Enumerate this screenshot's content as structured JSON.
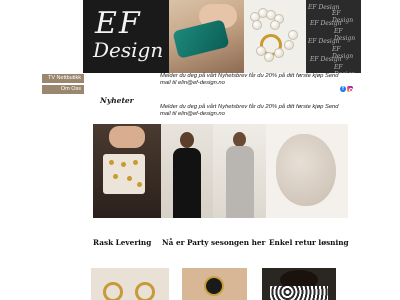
{
  "header": {
    "logo_line1": "EF",
    "logo_line2": "Design",
    "pattern_text": "EF Design"
  },
  "sidebar": {
    "items": [
      {
        "label": "TV Nettbutikk"
      },
      {
        "label": "Om Oss"
      }
    ]
  },
  "newsletter": {
    "top_text": "Melder du deg på vårt Nyhetsbrev får du 20% på ditt første kjøp Send mail til elin@ef-design.no",
    "heading": "Nyheter",
    "body_text": "Melder du deg på vårt Nyhetsbrev får du 20% på ditt første kjøp Send mail til elin@ef-design.no"
  },
  "social": {
    "facebook_icon": "facebook-icon",
    "instagram_icon": "instagram-icon"
  },
  "photos": [
    "jewelry-box",
    "woman-black-dress",
    "woman-grey-dress",
    "scarf"
  ],
  "features": {
    "shipping": "Rask Levering",
    "party": "Nå er Party sesongen her",
    "returns": "Enkel retur løsning"
  },
  "bottom_photos": [
    "earrings",
    "clover-ring",
    "leopard-dress"
  ],
  "colors": {
    "nav_bg": "#9b8770",
    "logo_bg": "#1a1a1a",
    "facebook": "#1877f2"
  }
}
